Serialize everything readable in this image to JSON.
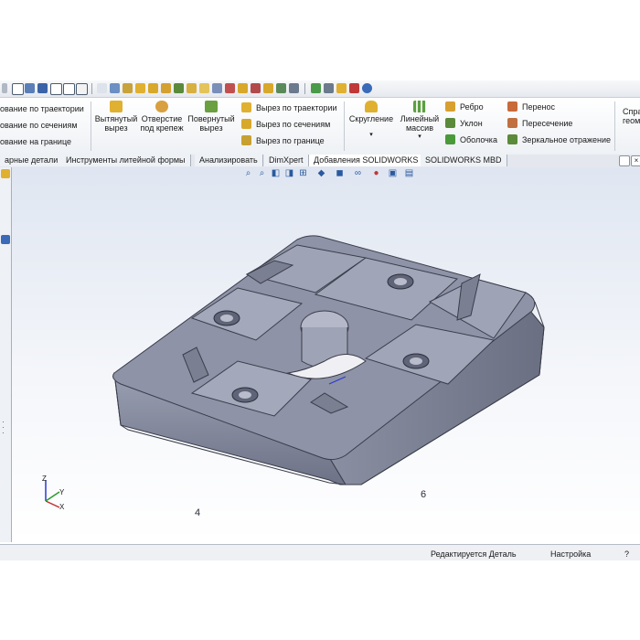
{
  "ribbon": {
    "left_items": [
      "ование по траектории",
      "ование по сечениям",
      "ование на границе"
    ],
    "extruded_cut": "Вытянутый вырез",
    "hole": "Отверстие под крепеж",
    "revolved_cut": "Повернутый вырез",
    "sweep_cut": "Вырез по траектории",
    "loft_cut": "Вырез по сечениям",
    "boundary_cut": "Вырез по границе",
    "fillet": "Скругление",
    "linear_pattern": "Линейный массив",
    "rib": "Ребро",
    "draft": "Уклон",
    "shell": "Оболочка",
    "move": "Перенос",
    "intersect": "Пересечение",
    "mirror": "Зеркальное отражение",
    "right_cut": "Спра геом"
  },
  "tabs": [
    "арные детали",
    "Инструменты литейной формы",
    "Анализировать",
    "DimXpert",
    "Добавления SOLIDWORKS",
    "SOLIDWORKS MBD"
  ],
  "triad": {
    "x": "X",
    "y": "Y",
    "z": "Z"
  },
  "model": {
    "label_left": "4",
    "label_right": "6"
  },
  "status": {
    "editing": "Редактируется Деталь",
    "settings": "Настройка"
  },
  "colors": {
    "model": "#8a8fa3",
    "accent": "#2a5aa0"
  }
}
